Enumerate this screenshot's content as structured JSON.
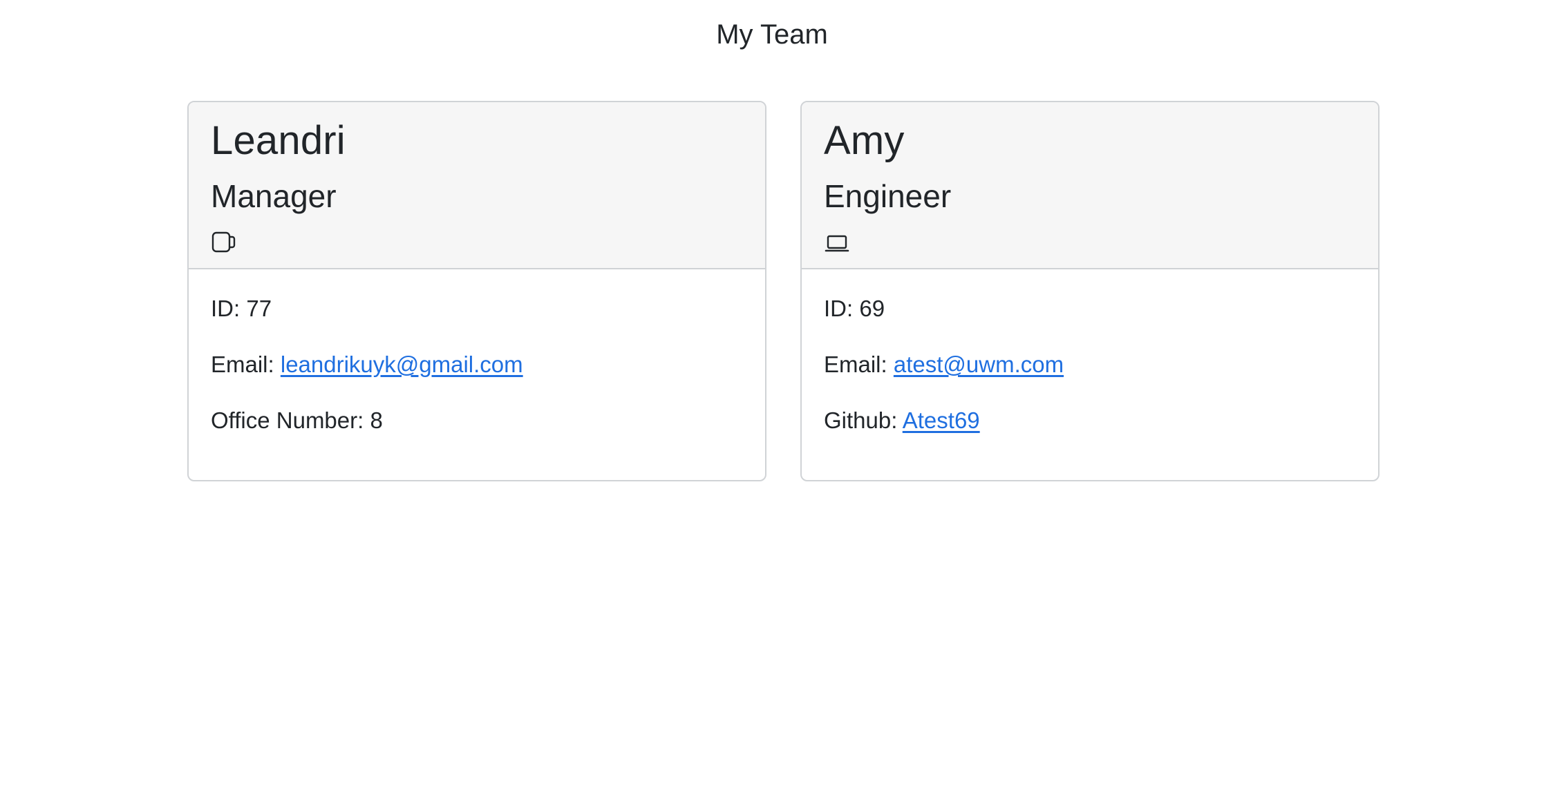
{
  "header": {
    "title": "My Team"
  },
  "cards": [
    {
      "name": "Leandri",
      "role": "Manager",
      "icon": "coffee-mug-icon",
      "id_label": "ID: ",
      "id": "77",
      "email_label": "Email: ",
      "email": "leandrikuyk@gmail.com",
      "extra_label": "Office Number: ",
      "extra_value": "8"
    },
    {
      "name": "Amy",
      "role": "Engineer",
      "icon": "laptop-icon",
      "id_label": "ID: ",
      "id": "69",
      "email_label": "Email: ",
      "email": "atest@uwm.com",
      "extra_label": "Github: ",
      "extra_value": "Atest69"
    }
  ],
  "colors": {
    "link": "#1f6fe0",
    "header_bg": "#f6f6f6",
    "text": "#212529"
  }
}
